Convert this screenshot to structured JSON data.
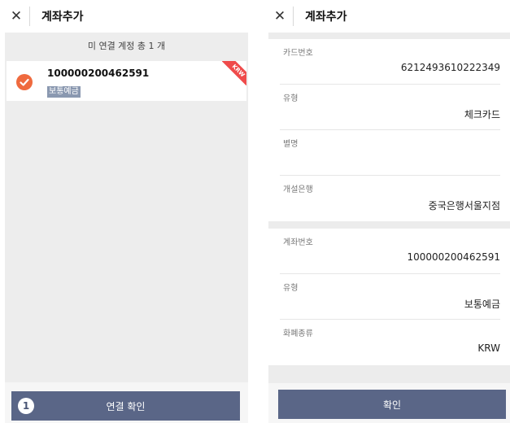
{
  "left": {
    "header": {
      "close_glyph": "✕",
      "title": "계좌추가"
    },
    "summary": "미 연결 계정 총 1 개",
    "account": {
      "number": "100000200462591",
      "type": "보통예금",
      "currency_ribbon": "KRW",
      "selected": true
    },
    "footer": {
      "step": "1",
      "button_label": "연결 확인"
    }
  },
  "right": {
    "header": {
      "close_glyph": "✕",
      "title": "계좌추가"
    },
    "card_section": [
      {
        "label": "카드번호",
        "value": "6212493610222349"
      },
      {
        "label": "유형",
        "value": "체크카드"
      },
      {
        "label": "별명",
        "value": ""
      },
      {
        "label": "개설은행",
        "value": "중국은행서울지점"
      }
    ],
    "account_section": [
      {
        "label": "계좌번호",
        "value": "100000200462591"
      },
      {
        "label": "유형",
        "value": "보통예금"
      },
      {
        "label": "화폐종류",
        "value": "KRW"
      }
    ],
    "footer": {
      "button_label": "확인"
    }
  },
  "colors": {
    "accent_button": "#5a6687",
    "check_orange": "#ef6a3e",
    "ribbon_red": "#ef4b4b"
  }
}
